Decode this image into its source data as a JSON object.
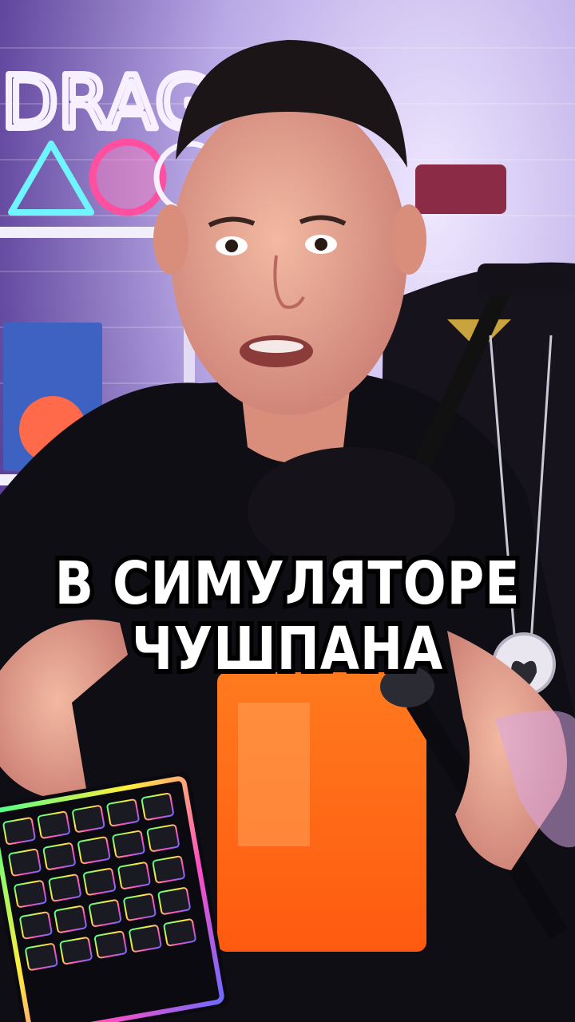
{
  "caption": {
    "line1": "В СИМУЛЯТОРЕ",
    "line2": "ЧУШПАНА"
  },
  "neon_sign": {
    "text": "DRAG"
  },
  "colors": {
    "wall": "#cfc6e6",
    "neon_pink": "#ff4fa0",
    "neon_cyan": "#6ff5ff",
    "neon_white": "#f6f0ff",
    "hoodie": "#0e0e14",
    "skin": "#e7a48f",
    "caption_text": "#ffffff",
    "caption_outline": "#000000"
  }
}
